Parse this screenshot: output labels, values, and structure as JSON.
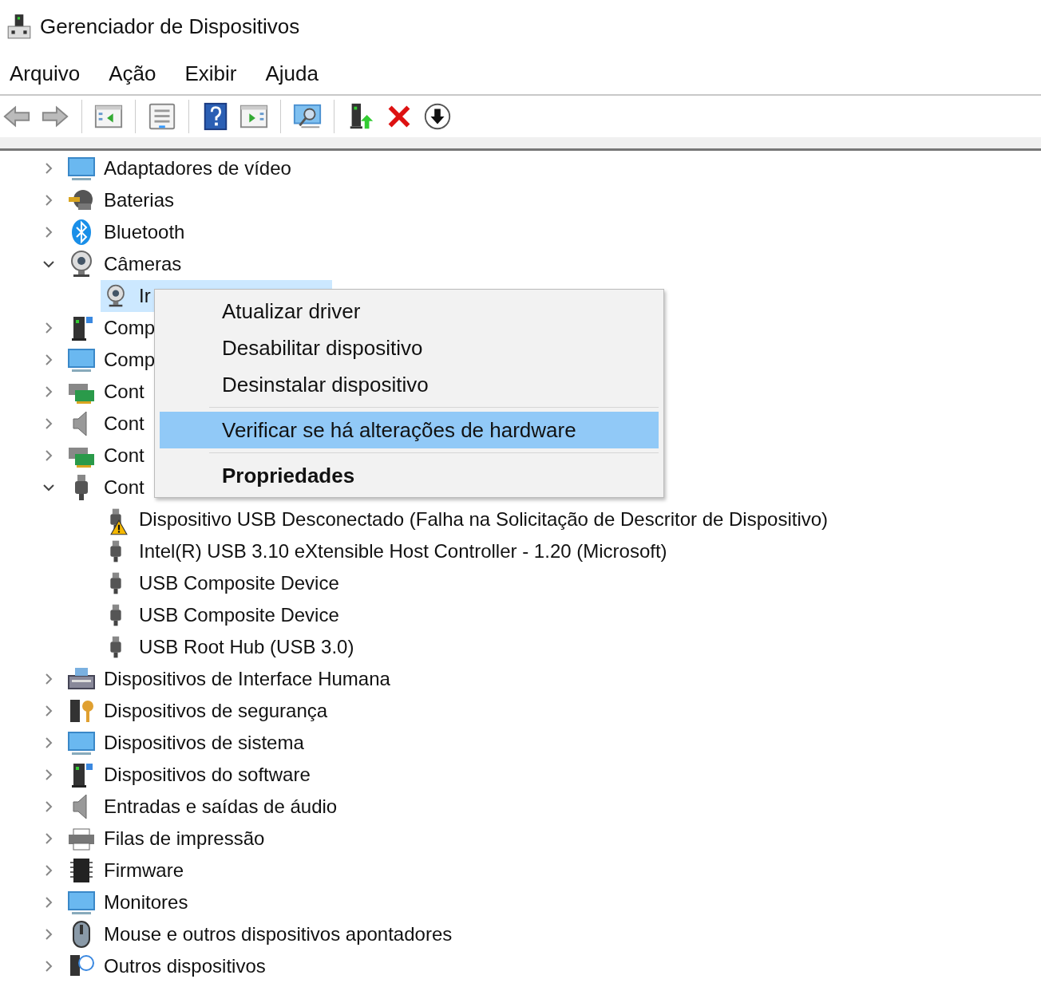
{
  "window": {
    "title": "Gerenciador de Dispositivos"
  },
  "menu_bar": [
    "Arquivo",
    "Ação",
    "Exibir",
    "Ajuda"
  ],
  "tree": [
    {
      "label": "Adaptadores de vídeo",
      "expanded": false,
      "selected": false
    },
    {
      "label": "Baterias",
      "expanded": false,
      "selected": false
    },
    {
      "label": "Bluetooth",
      "expanded": false,
      "selected": false
    },
    {
      "label": "Câmeras",
      "expanded": true,
      "selected": false,
      "children": [
        {
          "label": "Ir",
          "selected": true,
          "warning": false
        }
      ]
    },
    {
      "label": "Comp",
      "expanded": false,
      "selected": false
    },
    {
      "label": "Comp",
      "expanded": false,
      "selected": false
    },
    {
      "label": "Cont",
      "expanded": false,
      "selected": false
    },
    {
      "label": "Cont",
      "expanded": false,
      "selected": false
    },
    {
      "label": "Cont",
      "expanded": false,
      "selected": false
    },
    {
      "label": "Cont",
      "expanded": true,
      "selected": false,
      "children": [
        {
          "label": "Dispositivo USB Desconectado (Falha na Solicitação de Descritor de Dispositivo)",
          "selected": false,
          "warning": true
        },
        {
          "label": "Intel(R) USB 3.10 eXtensible Host Controller - 1.20 (Microsoft)",
          "selected": false,
          "warning": false
        },
        {
          "label": "USB Composite Device",
          "selected": false,
          "warning": false
        },
        {
          "label": "USB Composite Device",
          "selected": false,
          "warning": false
        },
        {
          "label": "USB Root Hub (USB 3.0)",
          "selected": false,
          "warning": false
        }
      ]
    },
    {
      "label": "Dispositivos de Interface Humana",
      "expanded": false,
      "selected": false
    },
    {
      "label": "Dispositivos de segurança",
      "expanded": false,
      "selected": false
    },
    {
      "label": "Dispositivos de sistema",
      "expanded": false,
      "selected": false
    },
    {
      "label": "Dispositivos do software",
      "expanded": false,
      "selected": false
    },
    {
      "label": "Entradas e saídas de áudio",
      "expanded": false,
      "selected": false
    },
    {
      "label": "Filas de impressão",
      "expanded": false,
      "selected": false
    },
    {
      "label": "Firmware",
      "expanded": false,
      "selected": false
    },
    {
      "label": "Monitores",
      "expanded": false,
      "selected": false
    },
    {
      "label": "Mouse e outros dispositivos apontadores",
      "expanded": false,
      "selected": false
    },
    {
      "label": "Outros dispositivos",
      "expanded": false,
      "selected": false
    }
  ],
  "context_menu": {
    "groups": [
      [
        {
          "label": "Atualizar driver",
          "selected": false,
          "default": false
        },
        {
          "label": "Desabilitar dispositivo",
          "selected": false,
          "default": false
        },
        {
          "label": "Desinstalar dispositivo",
          "selected": false,
          "default": false
        }
      ],
      [
        {
          "label": "Verificar se há alterações de hardware",
          "selected": true,
          "default": false
        }
      ],
      [
        {
          "label": "Propriedades",
          "selected": false,
          "default": true
        }
      ]
    ]
  }
}
